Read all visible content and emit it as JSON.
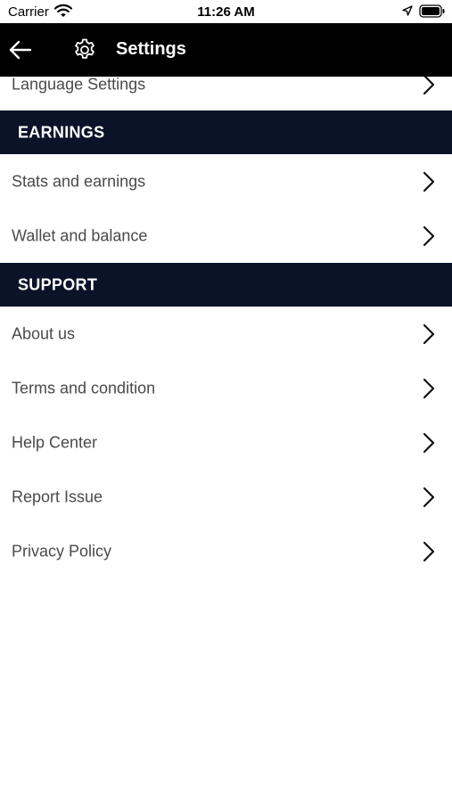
{
  "status_bar": {
    "carrier": "Carrier",
    "time": "11:26 AM"
  },
  "nav": {
    "title": "Settings",
    "back_icon": "arrow-left-icon",
    "title_icon": "gear-icon"
  },
  "rows_top": {
    "language": "Language Settings"
  },
  "earnings": {
    "header": "EARNINGS",
    "items": [
      "Stats and earnings",
      "Wallet and balance"
    ]
  },
  "support": {
    "header": "SUPPORT",
    "items": [
      "About us",
      "Terms and condition",
      "Help Center",
      "Report Issue",
      "Privacy Policy"
    ]
  },
  "colors": {
    "nav_background": "#000000",
    "section_background": "#0a1328",
    "row_text": "#4a4a4a"
  }
}
